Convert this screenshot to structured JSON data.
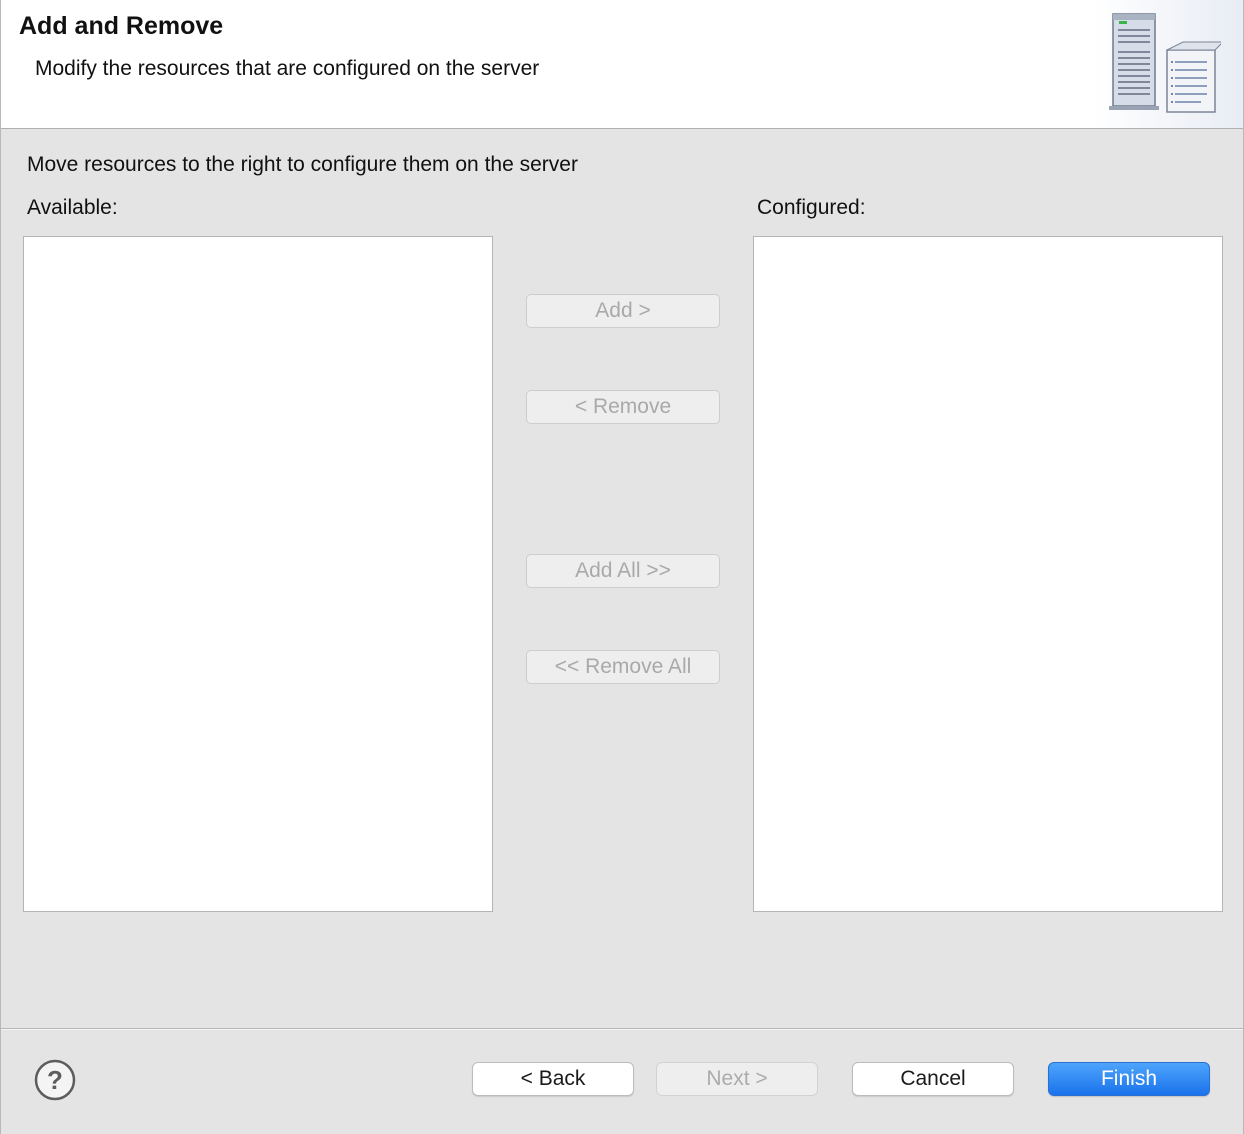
{
  "header": {
    "title": "Add and Remove",
    "description": "Modify the resources that are configured on the server",
    "icon": "server-document-icon"
  },
  "main": {
    "instruction": "Move resources to the right to configure them on the server",
    "available_label": "Available:",
    "configured_label": "Configured:",
    "available_items": [],
    "configured_items": [],
    "buttons": {
      "add": "Add >",
      "remove": "< Remove",
      "add_all": "Add All >>",
      "remove_all": "<< Remove All"
    }
  },
  "footer": {
    "help_icon": "help-icon",
    "back": "< Back",
    "next": "Next >",
    "cancel": "Cancel",
    "finish": "Finish"
  },
  "colors": {
    "accent": "#1a73ec",
    "dialog_background": "#e4e4e4",
    "disabled_text": "#a9a9a9"
  }
}
